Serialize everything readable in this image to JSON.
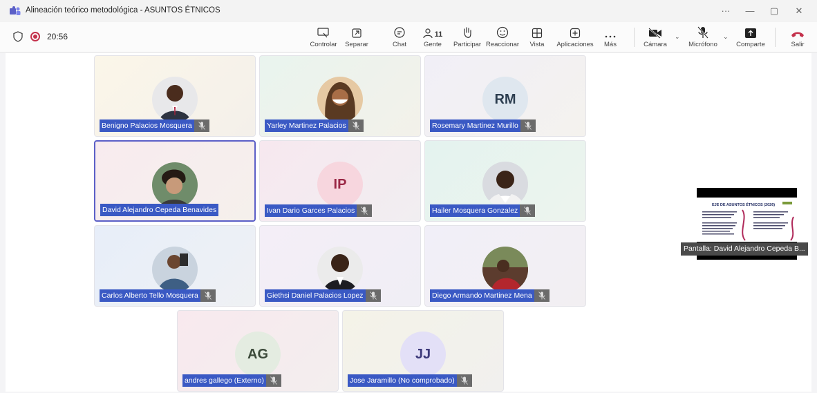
{
  "window": {
    "title": "Alineación teórico metodológica - ASUNTOS ÉTNICOS",
    "controls": [
      "···",
      "—",
      "▢",
      "✕"
    ]
  },
  "toolbar": {
    "timer": "20:56",
    "people_count": "11",
    "buttons": {
      "control": "Controlar",
      "separate": "Separar",
      "chat": "Chat",
      "people": "Gente",
      "raise": "Participar",
      "react": "Reaccionar",
      "view": "Vista",
      "apps": "Aplicaciones",
      "more": "Más",
      "camera": "Cámara",
      "mic": "Micrófono",
      "share": "Comparte",
      "leave": "Salir"
    },
    "leave_color": "#c4314b"
  },
  "participants": [
    {
      "name": "Benigno Palacios Mosquera",
      "initials": "",
      "bg": "#faf4e6"
    },
    {
      "name": "Yarley Martinez Palacios",
      "initials": "",
      "bg": "#eaf3ef"
    },
    {
      "name": "Rosemary Martinez Murillo",
      "initials": "RM",
      "bg": "#f1f0f6"
    },
    {
      "name": "David Alejandro Cepeda Benavides",
      "initials": "",
      "bg": "#f8ecef"
    },
    {
      "name": "Ivan Dario Garces Palacios",
      "initials": "IP",
      "bg": "#f7e9f0"
    },
    {
      "name": "Hailer Mosquera Gonzalez",
      "initials": "",
      "bg": "#e7f3f0"
    },
    {
      "name": "Carlos Alberto Tello Mosquera",
      "initials": "",
      "bg": "#e9eef8"
    },
    {
      "name": "Giethsi Daniel Palacios Lopez",
      "initials": "",
      "bg": "#f3eef6"
    },
    {
      "name": "Diego Armando Martinez Mena",
      "initials": "",
      "bg": "#f1eff7"
    },
    {
      "name": "andres gallego (Externo)",
      "initials": "AG",
      "bg": "#f7eaee"
    },
    {
      "name": "Jose Jaramillo (No comprobado)",
      "initials": "JJ",
      "bg": "#f3f2ea"
    }
  ],
  "screen_share": {
    "label": "Pantalla: David Alejandro Cepeda B...",
    "slide_title": "EJE DE ASUNTOS ÉTNICOS (2026)"
  }
}
